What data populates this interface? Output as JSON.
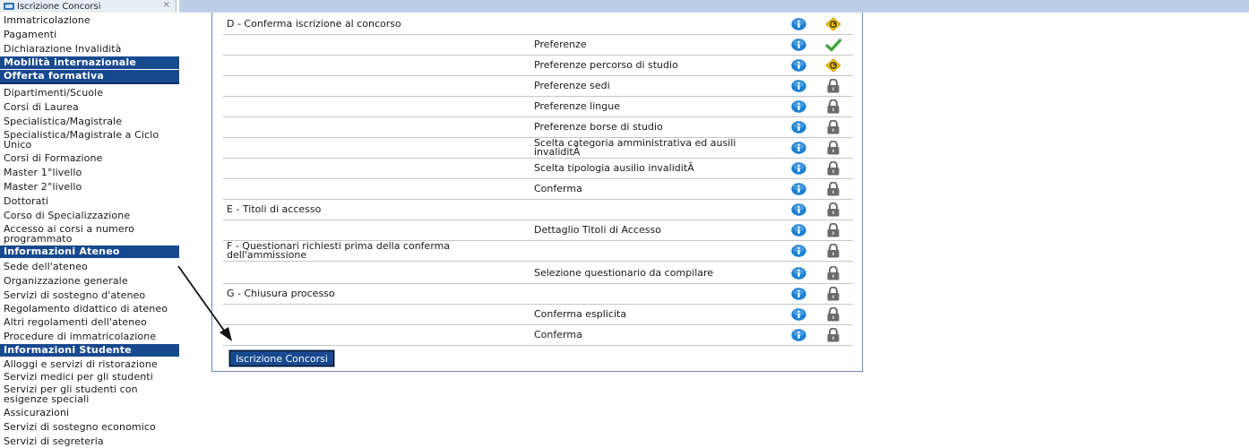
{
  "tab": {
    "title": "Iscrizione Concorsi",
    "close": "×"
  },
  "sidebar": {
    "items_top": [
      "Immatricolazione",
      "Pagamenti",
      "Dichiarazione Invalidità"
    ],
    "header_mobilita": "Mobilità internazionale",
    "header_offerta": "Offerta formativa",
    "offerta_items": [
      "Dipartimenti/Scuole",
      "Corsi di Laurea",
      "Specialistica/Magistrale",
      "Specialistica/Magistrale a Ciclo Unico",
      "Corsi di Formazione",
      "Master 1°livello",
      "Master 2°livello",
      "Dottorati",
      "Corso di Specializzazione",
      "Accesso ai corsi a numero programmato"
    ],
    "header_ateneo": "Informazioni Ateneo",
    "ateneo_items": [
      "Sede dell'ateneo",
      "Organizzazione generale",
      "Servizi di sostegno d'ateneo",
      "Regolamento didattico di ateneo",
      "Altri regolamenti dell'ateneo",
      "Procedure di immatricolazione"
    ],
    "header_studente": "Informazioni Studente",
    "studente_items": [
      "Alloggi e servizi di ristorazione",
      "Servizi medici per gli studenti",
      "Servizi per gli studenti con esigenze speciali",
      "Assicurazioni",
      "Servizi di sostegno economico",
      "Servizi di segreteria"
    ]
  },
  "steps": [
    {
      "section": "D - Conferma iscrizione al concorso",
      "step": "",
      "status": "warning"
    },
    {
      "section": "",
      "step": "Preferenze",
      "status": "done"
    },
    {
      "section": "",
      "step": "Preferenze percorso di studio",
      "status": "warning"
    },
    {
      "section": "",
      "step": "Preferenze sedi",
      "status": "locked"
    },
    {
      "section": "",
      "step": "Preferenze lingue",
      "status": "locked"
    },
    {
      "section": "",
      "step": "Preferenze borse di studio",
      "status": "locked"
    },
    {
      "section": "",
      "step": "Scelta categoria amministrativa ed ausili invaliditÃ",
      "status": "locked"
    },
    {
      "section": "",
      "step": "Scelta tipologia ausilio invaliditÃ",
      "status": "locked"
    },
    {
      "section": "",
      "step": "Conferma",
      "status": "locked"
    },
    {
      "section": "E - Titoli di accesso",
      "step": "",
      "status": "locked"
    },
    {
      "section": "",
      "step": "Dettaglio Titoli di Accesso",
      "status": "locked"
    },
    {
      "section": "F - Questionari richiesti prima della conferma dell'ammissione",
      "step": "",
      "status": "locked"
    },
    {
      "section": "",
      "step": "Selezione questionario da compilare",
      "status": "locked"
    },
    {
      "section": "G - Chiusura processo",
      "step": "",
      "status": "locked"
    },
    {
      "section": "",
      "step": "Conferma esplicita",
      "status": "locked"
    },
    {
      "section": "",
      "step": "Conferma",
      "status": "locked"
    }
  ],
  "button": {
    "label": "Iscrizione Concorsi"
  },
  "colors": {
    "sidebar_header": "#17498f",
    "info_blue": "#1d7fd0",
    "check_green": "#3aa535",
    "warning_yellow": "#f2c200",
    "lock_gray": "#6b6b6b"
  },
  "icons": {
    "info": "info-icon",
    "done": "check-icon",
    "warning": "warning-icon",
    "locked": "lock-icon"
  }
}
